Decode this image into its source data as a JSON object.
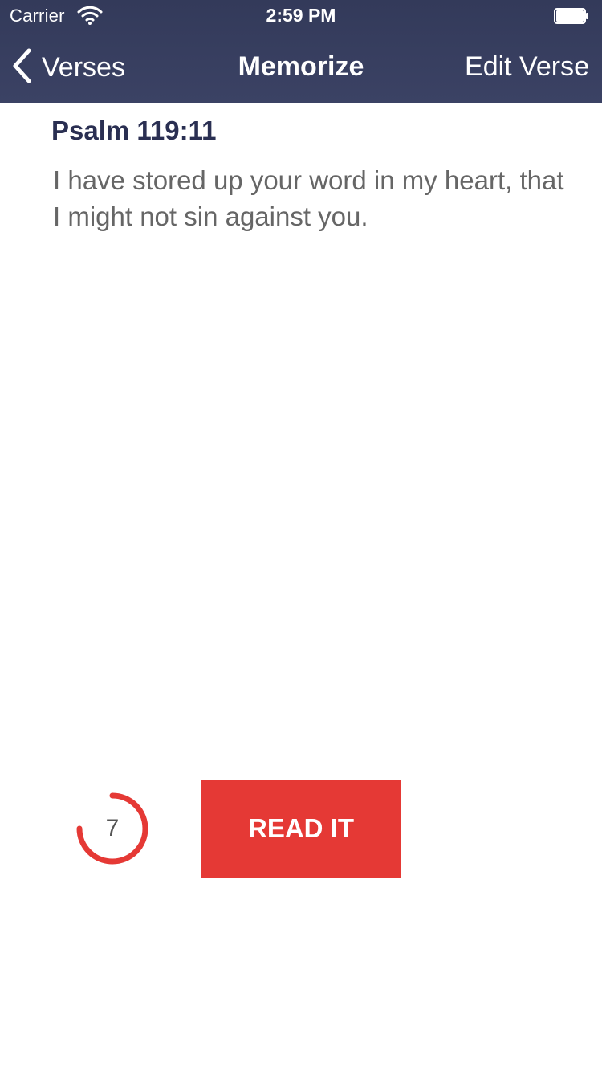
{
  "status_bar": {
    "carrier": "Carrier",
    "time": "2:59 PM",
    "wifi_icon": "wifi-icon",
    "battery_icon": "battery-icon"
  },
  "nav": {
    "back_label": "Verses",
    "back_icon": "chevron-left-icon",
    "title": "Memorize",
    "edit_label": "Edit Verse"
  },
  "verse": {
    "reference": "Psalm 119:11",
    "text": "I have stored up your word in my heart, that I might not sin against you."
  },
  "timer": {
    "count": "7",
    "progress_fraction": 0.75
  },
  "action": {
    "label": "READ IT"
  },
  "colors": {
    "nav_background": "#363d5f",
    "accent_red": "#e53935",
    "reference_text": "#2a2f52",
    "verse_text": "#666666"
  }
}
